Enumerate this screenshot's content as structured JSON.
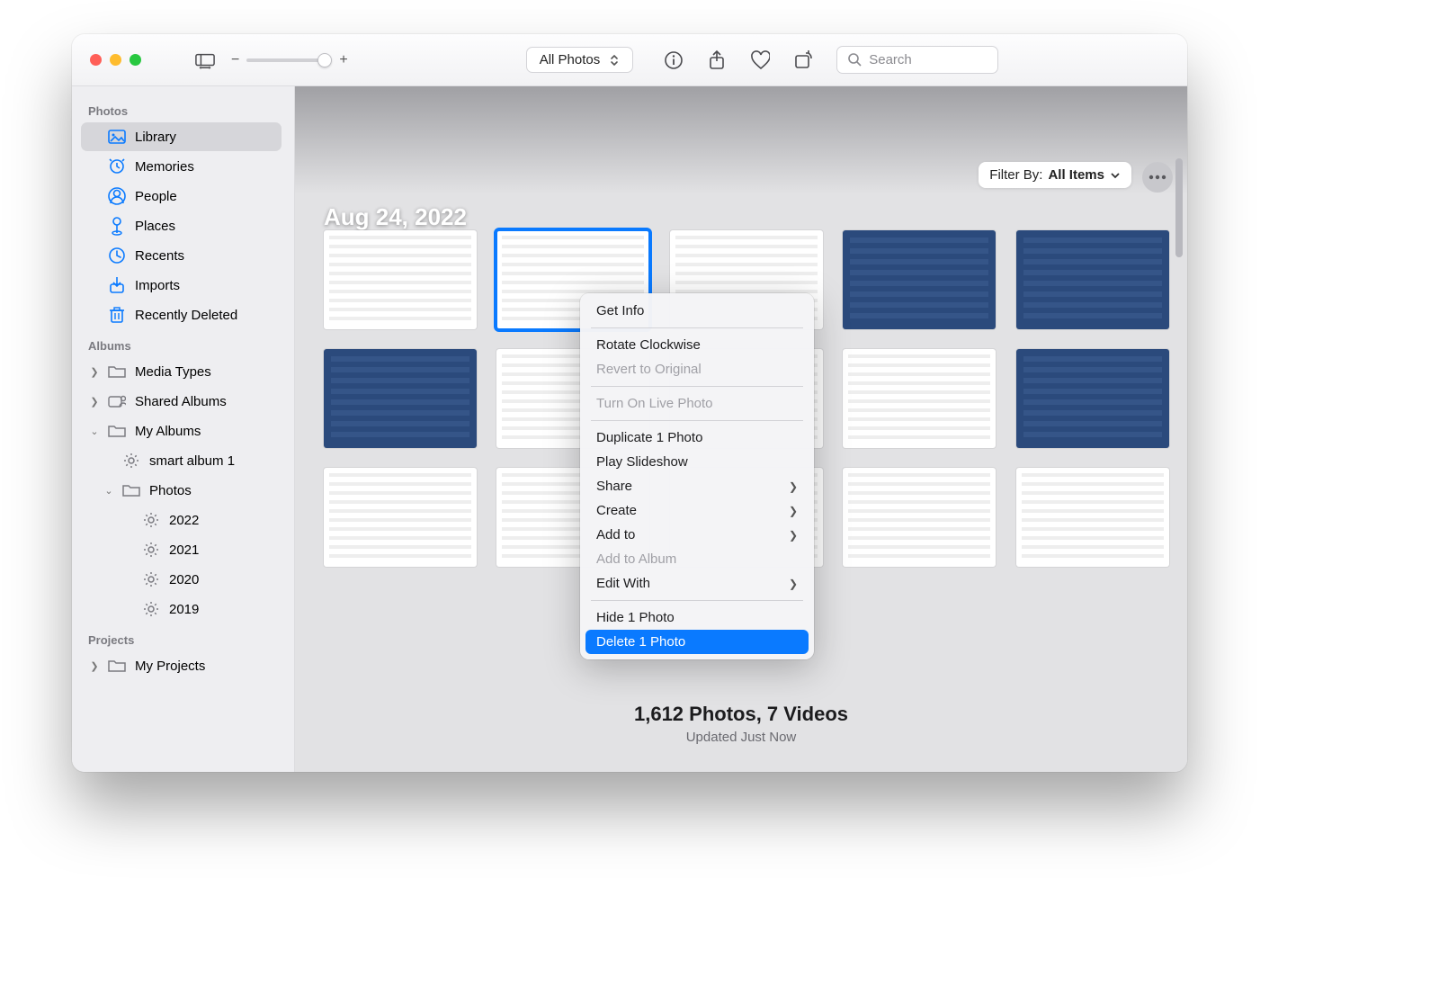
{
  "toolbar": {
    "view_selector": "All Photos",
    "search_placeholder": "Search"
  },
  "filter": {
    "prefix": "Filter By:",
    "value": "All Items"
  },
  "date_header": "Aug 24, 2022",
  "sidebar": {
    "section_photos": "Photos",
    "photos": [
      {
        "label": "Library",
        "icon": "library",
        "selected": true
      },
      {
        "label": "Memories",
        "icon": "memories"
      },
      {
        "label": "People",
        "icon": "people"
      },
      {
        "label": "Places",
        "icon": "places"
      },
      {
        "label": "Recents",
        "icon": "recents"
      },
      {
        "label": "Imports",
        "icon": "imports"
      },
      {
        "label": "Recently Deleted",
        "icon": "trash"
      }
    ],
    "section_albums": "Albums",
    "albums": [
      {
        "label": "Media Types",
        "arrow": ">",
        "icon": "folder-grey"
      },
      {
        "label": "Shared Albums",
        "arrow": ">",
        "icon": "shared"
      },
      {
        "label": "My Albums",
        "arrow": "v",
        "icon": "folder-grey"
      }
    ],
    "my_albums": [
      {
        "label": "smart album 1",
        "icon": "gear"
      },
      {
        "label": "Photos",
        "arrow": "v",
        "icon": "folder-grey"
      }
    ],
    "photos_years": [
      {
        "label": "2022",
        "icon": "gear"
      },
      {
        "label": "2021",
        "icon": "gear"
      },
      {
        "label": "2020",
        "icon": "gear"
      },
      {
        "label": "2019",
        "icon": "gear"
      }
    ],
    "section_projects": "Projects",
    "projects": [
      {
        "label": "My Projects",
        "arrow": ">",
        "icon": "folder-grey"
      }
    ]
  },
  "context_menu": [
    {
      "label": "Get Info"
    },
    {
      "sep": true
    },
    {
      "label": "Rotate Clockwise"
    },
    {
      "label": "Revert to Original",
      "disabled": true
    },
    {
      "sep": true
    },
    {
      "label": "Turn On Live Photo",
      "disabled": true
    },
    {
      "sep": true
    },
    {
      "label": "Duplicate 1 Photo"
    },
    {
      "label": "Play Slideshow"
    },
    {
      "label": "Share",
      "submenu": true
    },
    {
      "label": "Create",
      "submenu": true
    },
    {
      "label": "Add to",
      "submenu": true
    },
    {
      "label": "Add to Album",
      "disabled": true
    },
    {
      "label": "Edit With",
      "submenu": true
    },
    {
      "sep": true
    },
    {
      "label": "Hide 1 Photo"
    },
    {
      "label": "Delete 1 Photo",
      "highlight": true
    }
  ],
  "summary": {
    "counts": "1,612 Photos, 7 Videos",
    "updated": "Updated Just Now"
  },
  "thumbnails": {
    "rows": 3,
    "cols": 5,
    "selected_index": 1,
    "styles": [
      "light",
      "light",
      "light",
      "dark",
      "dark",
      "dark",
      "light",
      "light",
      "light",
      "dark",
      "light",
      "light",
      "light",
      "light",
      "light"
    ]
  }
}
